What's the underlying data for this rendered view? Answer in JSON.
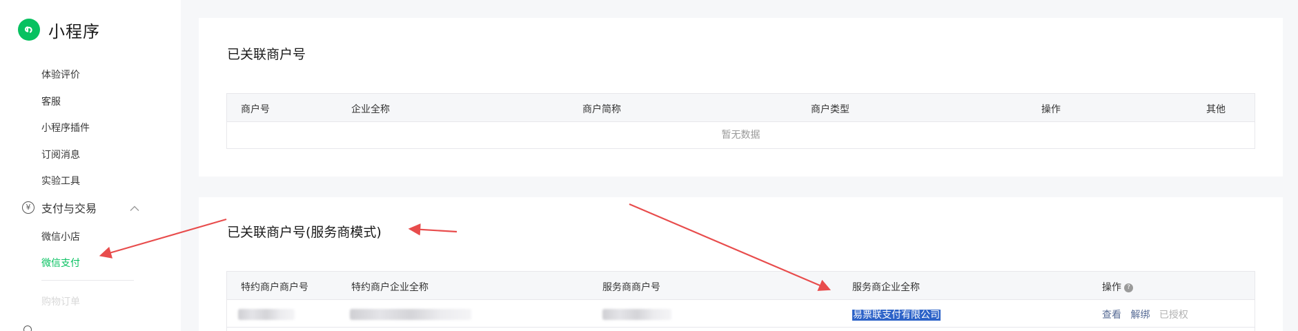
{
  "brand": {
    "name": "小程序",
    "icon": "mini-program-logo-icon",
    "color": "#07c160"
  },
  "sidebar": {
    "items": [
      {
        "label": "体验评价"
      },
      {
        "label": "客服"
      },
      {
        "label": "小程序插件"
      },
      {
        "label": "订阅消息"
      },
      {
        "label": "实验工具"
      }
    ],
    "group": {
      "label": "支付与交易",
      "icon": "yen-icon",
      "expanded": true
    },
    "sub_items": [
      {
        "label": "微信小店"
      },
      {
        "label": "微信支付",
        "active": true
      },
      {
        "label": "购物订单"
      }
    ]
  },
  "section1": {
    "title": "已关联商户号",
    "columns": [
      "商户号",
      "企业全称",
      "商户简称",
      "商户类型",
      "操作",
      "其他"
    ],
    "empty_text": "暂无数据"
  },
  "section2": {
    "title": "已关联商户号(服务商模式)",
    "columns": [
      "特约商户商户号",
      "特约商户企业全称",
      "服务商商户号",
      "服务商企业全称",
      "操作"
    ],
    "rows": [
      {
        "provider_name": "易票联支付有限公司",
        "actions": {
          "view": "查看",
          "unbind": "解绑",
          "authorized": "已授权"
        }
      }
    ]
  },
  "colors": {
    "accent": "#07c160",
    "link": "#576b95",
    "annotation_arrow": "#e84c4c",
    "selection": "#2d63c8"
  }
}
